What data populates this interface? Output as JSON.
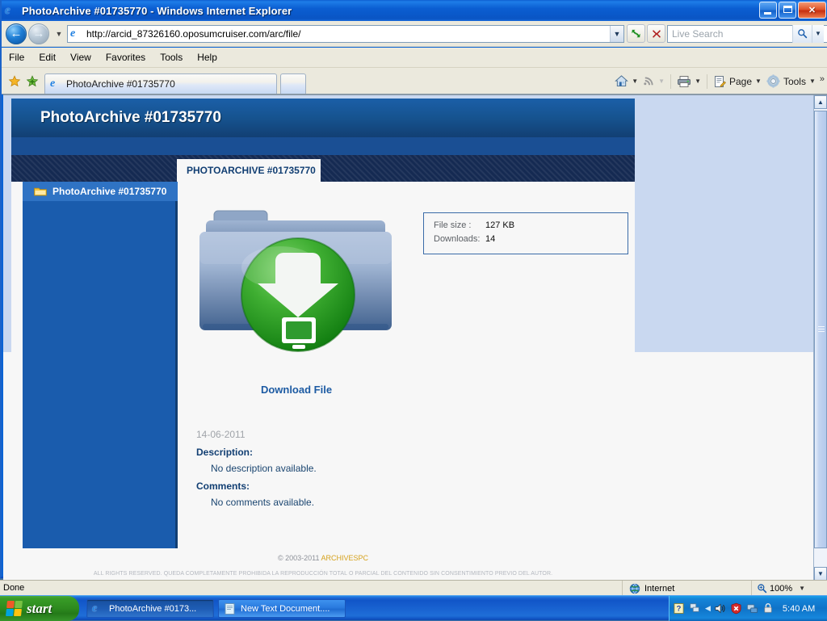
{
  "window": {
    "title": "PhotoArchive #01735770 - Windows Internet Explorer",
    "icon": "ie-logo-icon",
    "minimize_label": "Minimize",
    "restore_label": "Restore",
    "close_label": "Close"
  },
  "navbar": {
    "back_label": "Back",
    "forward_label": "Forward",
    "history_dropdown": "▼",
    "url": "http://arcid_87326160.oposumcruiser.com/arc/file/",
    "url_dropdown": "▼",
    "refresh_label": "Refresh",
    "stop_label": "Stop"
  },
  "search": {
    "placeholder": "Live Search",
    "value": "",
    "go_label": "Search",
    "dropdown": "▼"
  },
  "menubar": {
    "items": [
      {
        "label": "File"
      },
      {
        "label": "Edit"
      },
      {
        "label": "View"
      },
      {
        "label": "Favorites"
      },
      {
        "label": "Tools"
      },
      {
        "label": "Help"
      }
    ]
  },
  "favorites": {
    "star_label": "Favorites Center",
    "add_label": "Add to Favorites"
  },
  "tabs": [
    {
      "label": "PhotoArchive #01735770",
      "icon": "ie-logo-icon",
      "active": true
    },
    {
      "label": "",
      "icon": "new-tab-icon",
      "active": false
    }
  ],
  "commandbar": {
    "items": [
      {
        "name": "home",
        "label": "",
        "has_carat": true
      },
      {
        "name": "feeds",
        "label": "",
        "has_carat": true
      },
      {
        "name": "print",
        "label": "",
        "has_carat": true
      },
      {
        "name": "page",
        "label": "Page",
        "has_carat": true
      },
      {
        "name": "tools",
        "label": "Tools",
        "has_carat": true
      }
    ],
    "overflow": "»"
  },
  "page": {
    "header_title": "PhotoArchive #01735770",
    "content_tab_label": "PHOTOARCHIVE #01735770",
    "sidebar": {
      "items": [
        {
          "label": "PhotoArchive #01735770",
          "icon": "folder-icon",
          "selected": true
        }
      ]
    },
    "download": {
      "icon": "download-folder-icon",
      "link_label": "Download File"
    },
    "info": {
      "rows": [
        {
          "key": "File size :",
          "value": "127 KB"
        },
        {
          "key": "Downloads:",
          "value": "14"
        }
      ]
    },
    "meta": {
      "date": "14-06-2011",
      "description_heading": "Description:",
      "description_body": "No description available.",
      "comments_heading": "Comments:",
      "comments_body": "No comments available."
    },
    "footer": {
      "copyright": "© 2003-2011",
      "brand": "ARCHIVESPC",
      "rights": "ALL RIGHTS RESERVED. QUEDA COMPLETAMENTE PROHIBIDA LA REPRODUCCIÓN TOTAL O PARCIAL DEL CONTENIDO SIN CONSENTIMIENTO PREVIO DEL AUTOR."
    },
    "scrollbar": {
      "up": "▲",
      "down": "▼"
    }
  },
  "statusbar": {
    "status": "Done",
    "zone": "Internet",
    "zoom": "100%",
    "zoom_dropdown": "▼"
  },
  "taskbar": {
    "start_label": "start",
    "items": [
      {
        "label": "PhotoArchive #0173...",
        "icon": "ie-logo-icon",
        "active": true
      },
      {
        "label": "New Text Document....",
        "icon": "notepad-icon",
        "active": false
      }
    ],
    "tray": {
      "clock": "5:40 AM",
      "expand": "◀",
      "icons": [
        "help-icon",
        "network-activity-icon",
        "volume-icon",
        "security-alert-icon",
        "network-icon",
        "lock-icon"
      ]
    }
  },
  "colors": {
    "title_blue": "#0a55c4",
    "site_header_blue": "#16538f",
    "sidebar_blue": "#1a5cad",
    "link_blue": "#1d5ba3",
    "page_bg": "#c9d8f0",
    "brand_gold": "#d6a21c",
    "download_green": "#2f9e2f"
  }
}
